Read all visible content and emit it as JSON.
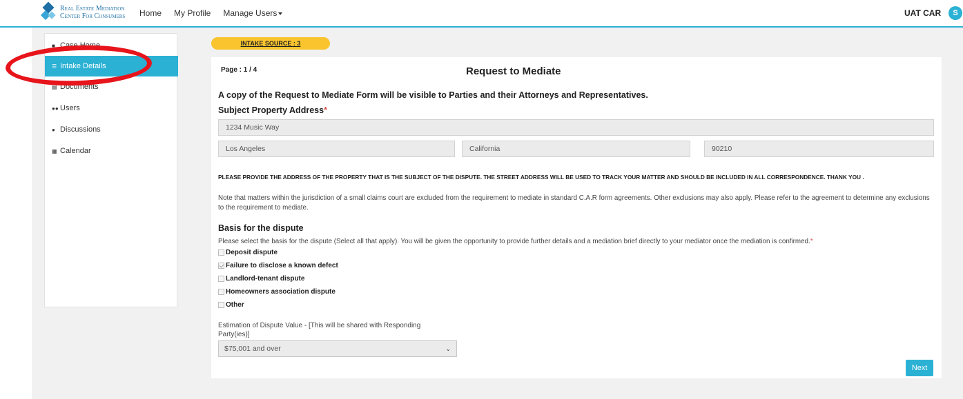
{
  "header": {
    "logo_line1": "Real Estate Mediation",
    "logo_line2": "Center For Consumers",
    "nav": [
      "Home",
      "My Profile",
      "Manage Users"
    ],
    "org_name": "UAT CAR",
    "avatar_initial": "S"
  },
  "sidebar": {
    "items": [
      {
        "label": "Case Home",
        "icon": "briefcase-icon"
      },
      {
        "label": "Intake Details",
        "icon": "list-icon",
        "active": true
      },
      {
        "label": "Documents",
        "icon": "file-icon"
      },
      {
        "label": "Users",
        "icon": "users-icon"
      },
      {
        "label": "Discussions",
        "icon": "chat-icon"
      },
      {
        "label": "Calendar",
        "icon": "calendar-icon"
      }
    ]
  },
  "intake_source": "INTAKE SOURCE : 3",
  "form": {
    "page_indicator": "Page : 1 / 4",
    "title": "Request to Mediate",
    "visibility_note": "A copy of the Request to Mediate Form will be visible to Parties and their Attorneys and Representatives.",
    "address_label": "Subject Property Address",
    "required_mark": "*",
    "street": "1234 Music Way",
    "city": "Los Angeles",
    "state": "California",
    "zip": "90210",
    "caps_note": "PLEASE PROVIDE THE ADDRESS OF THE PROPERTY THAT IS THE SUBJECT OF THE DISPUTE. THE STREET ADDRESS WILL BE USED TO TRACK YOUR MATTER AND SHOULD BE INCLUDED IN ALL CORRESPONDENCE. THANK YOU .",
    "small_claims_note": "Note that matters within the jurisdiction of a small claims court are excluded from the requirement to mediate in standard C.A.R form agreements. Other exclusions may also apply. Please refer to the agreement to determine any exclusions to the requirement to mediate.",
    "basis_title": "Basis for the dispute",
    "basis_desc": "Please select the basis for the dispute (Select all that apply). You will be given the opportunity to provide further details and a mediation brief directly to your mediator once the mediation is confirmed.",
    "options": [
      {
        "label": "Deposit dispute",
        "checked": false
      },
      {
        "label": "Failure to disclose a known defect",
        "checked": true
      },
      {
        "label": "Landlord-tenant dispute",
        "checked": false
      },
      {
        "label": "Homeowners association dispute",
        "checked": false
      },
      {
        "label": "Other",
        "checked": false
      }
    ],
    "estimation_label": "Estimation of Dispute Value - [This will be shared with Responding Party(ies)]",
    "estimation_value": "$75,001 and over",
    "next_label": "Next"
  },
  "colors": {
    "accent": "#2bb1d4",
    "pill": "#f9c42e",
    "annotation": "#e8141b"
  }
}
